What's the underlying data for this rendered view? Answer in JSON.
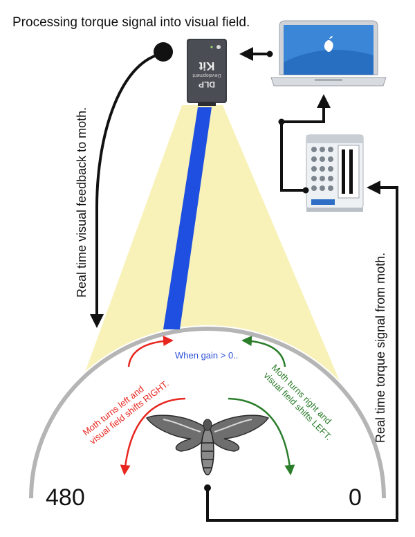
{
  "title": "Processing torque signal into visual field.",
  "labels": {
    "feedback": "Real time visual feedback to moth.",
    "torque": "Real time torque signal from moth.",
    "gain": "When gain > 0..",
    "left_line1": "Moth turns left and",
    "left_line2": "visual field shifts RIGHT.",
    "right_line1": "Moth turns right and",
    "right_line2": "visual field shifts LEFT.",
    "scale_left": "480",
    "scale_right": "0"
  },
  "projector": {
    "line1": "DLP",
    "line2": "Development",
    "line3": "Kit"
  },
  "colors": {
    "stripe": "#1f4fe0",
    "light_cone": "#f8f2b8",
    "arena_arc": "#b5b5b5",
    "left_text": "#e8261f",
    "right_text": "#2a7d2a",
    "gain_text": "#2a4fd8",
    "wire": "#111111"
  },
  "icons": [
    "projector-icon",
    "laptop-icon",
    "daq-board-icon",
    "moth-icon"
  ]
}
